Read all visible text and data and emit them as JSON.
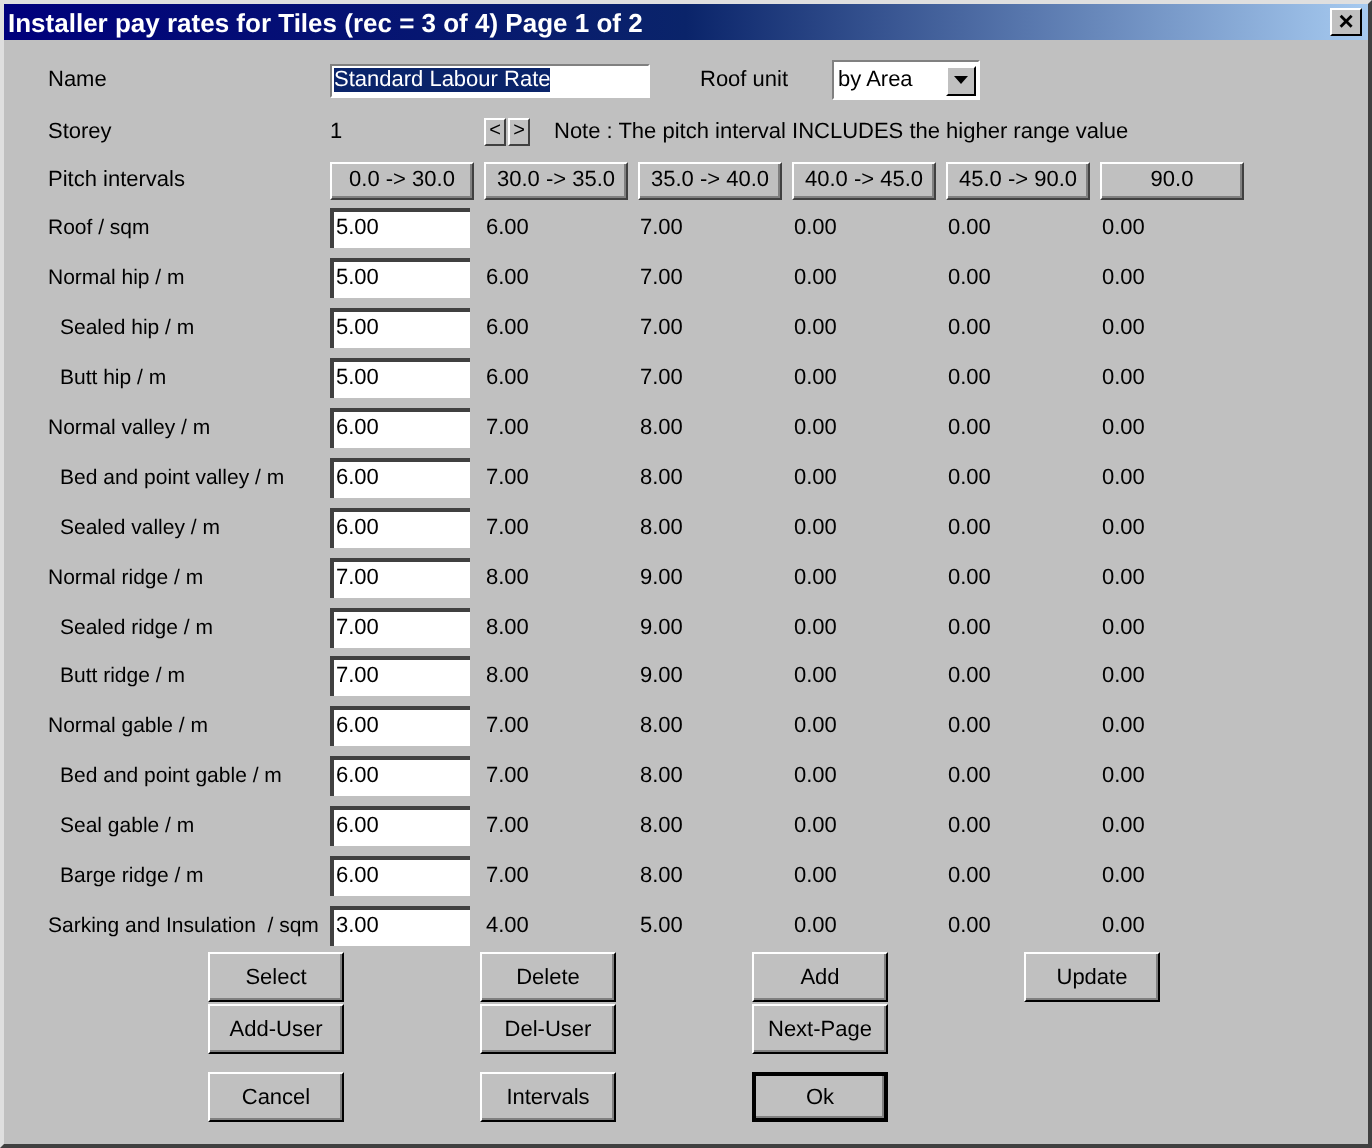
{
  "window": {
    "title": "Installer pay rates for Tiles (rec = 3 of 4) Page 1 of 2",
    "close": "×"
  },
  "name": {
    "label": "Name",
    "value": "Standard Labour Rate"
  },
  "roof_unit": {
    "label": "Roof unit",
    "value": "by Area"
  },
  "storey": {
    "label": "Storey",
    "value": "1",
    "prev": "<",
    "next": ">",
    "note": "Note : The pitch interval INCLUDES the higher range value"
  },
  "pitch_intervals": {
    "label": "Pitch intervals",
    "buttons": [
      "0.0 -> 30.0",
      "30.0 -> 35.0",
      "35.0 -> 40.0",
      "40.0 -> 45.0",
      "45.0 -> 90.0",
      "90.0"
    ]
  },
  "rates": [
    {
      "label": "Roof / sqm",
      "value": "5.00",
      "others": [
        "6.00",
        "7.00",
        "0.00",
        "0.00",
        "0.00"
      ]
    },
    {
      "label": "Normal hip / m",
      "value": "5.00",
      "others": [
        "6.00",
        "7.00",
        "0.00",
        "0.00",
        "0.00"
      ],
      "children": [
        {
          "label": "Sealed hip / m",
          "value": "5.00",
          "others": [
            "6.00",
            "7.00",
            "0.00",
            "0.00",
            "0.00"
          ]
        },
        {
          "label": "Butt hip / m",
          "value": "5.00",
          "others": [
            "6.00",
            "7.00",
            "0.00",
            "0.00",
            "0.00"
          ]
        }
      ]
    },
    {
      "label": "Normal valley / m",
      "value": "6.00",
      "others": [
        "7.00",
        "8.00",
        "0.00",
        "0.00",
        "0.00"
      ],
      "children": [
        {
          "label": "Bed and point valley / m",
          "value": "6.00",
          "others": [
            "7.00",
            "8.00",
            "0.00",
            "0.00",
            "0.00"
          ]
        },
        {
          "label": "Sealed valley / m",
          "value": "6.00",
          "others": [
            "7.00",
            "8.00",
            "0.00",
            "0.00",
            "0.00"
          ]
        }
      ]
    },
    {
      "label": "Normal ridge / m",
      "value": "7.00",
      "others": [
        "8.00",
        "9.00",
        "0.00",
        "0.00",
        "0.00"
      ],
      "children": [
        {
          "label": "Sealed ridge / m",
          "value": "7.00",
          "others": [
            "8.00",
            "9.00",
            "0.00",
            "0.00",
            "0.00"
          ]
        },
        {
          "label": "Butt ridge / m",
          "value": "7.00",
          "others": [
            "8.00",
            "9.00",
            "0.00",
            "0.00",
            "0.00"
          ]
        }
      ]
    },
    {
      "label": "Normal gable / m",
      "value": "6.00",
      "others": [
        "7.00",
        "8.00",
        "0.00",
        "0.00",
        "0.00"
      ],
      "children": [
        {
          "label": "Bed and point gable / m",
          "value": "6.00",
          "others": [
            "7.00",
            "8.00",
            "0.00",
            "0.00",
            "0.00"
          ]
        },
        {
          "label": "Seal gable / m",
          "value": "6.00",
          "others": [
            "7.00",
            "8.00",
            "0.00",
            "0.00",
            "0.00"
          ]
        },
        {
          "label": "Barge ridge / m",
          "value": "6.00",
          "others": [
            "7.00",
            "8.00",
            "0.00",
            "0.00",
            "0.00"
          ]
        }
      ]
    },
    {
      "label": "Sarking and Insulation  / sqm",
      "value": "3.00",
      "others": [
        "4.00",
        "5.00",
        "0.00",
        "0.00",
        "0.00"
      ]
    }
  ],
  "button_rows": [
    [
      {
        "label": "Select",
        "default": false
      },
      {
        "label": "Delete",
        "default": false
      },
      {
        "label": "Add",
        "default": false
      },
      {
        "label": "Update",
        "default": false
      }
    ],
    [
      {
        "label": "Add-User",
        "default": false
      },
      {
        "label": "Del-User",
        "default": false
      },
      {
        "label": "Next-Page",
        "default": false
      }
    ],
    [
      {
        "label": "Cancel",
        "default": false
      },
      {
        "label": "Intervals",
        "default": false
      },
      {
        "label": "Ok",
        "default": true
      }
    ]
  ]
}
